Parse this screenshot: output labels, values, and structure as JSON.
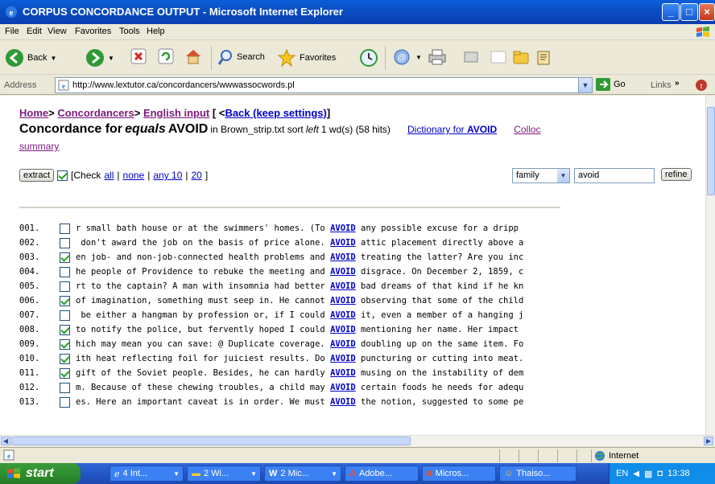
{
  "window": {
    "title": "CORPUS CONCORDANCE OUTPUT - Microsoft Internet Explorer",
    "minimize": "_",
    "maximize": "□",
    "close": "×"
  },
  "menu": [
    "File",
    "Edit",
    "View",
    "Favorites",
    "Tools",
    "Help"
  ],
  "toolbar": {
    "back": "Back",
    "search": "Search",
    "favorites": "Favorites"
  },
  "address": {
    "label": "Address",
    "url": "http://www.lextutor.ca/concordancers/wwwassocwords.pl",
    "go": "Go",
    "links": "Links"
  },
  "page": {
    "breadcrumb": {
      "home": "Home",
      "concordancers": "Concordancers",
      "english_input": "English input",
      "back_open": "[ <",
      "back": "Back (keep settings)",
      "back_close": "]"
    },
    "heading": {
      "concordance_for": "Concordance for",
      "equals": "equals",
      "keyword": "AVOID",
      "in_file": "in Brown_strip.txt sort",
      "left": "left",
      "rest": "1 wd(s) (58 hits)",
      "dictionary": "Dictionary for AVOID",
      "colloc": "Colloc",
      "summary": "summary"
    },
    "controls": {
      "extract": "extract",
      "check_prefix": "[Check",
      "all": "all",
      "none": "none",
      "any10": "any 10",
      "n20": "20",
      "suffix": "]",
      "family": "family",
      "search_value": "avoid",
      "refine": "refine"
    },
    "lines": [
      {
        "num": "001.",
        "checked": false,
        "left": "r small bath house or at the swimmers' homes. (To ",
        "kw": "AVOID",
        "right": " any possible excuse for a dripp"
      },
      {
        "num": "002.",
        "checked": false,
        "left": " don't award the job on the basis of price alone. ",
        "kw": "AVOID",
        "right": " attic placement directly above a"
      },
      {
        "num": "003.",
        "checked": true,
        "left": "en job- and non-job-connected health problems and ",
        "kw": "AVOID",
        "right": " treating the latter? Are you inc"
      },
      {
        "num": "004.",
        "checked": false,
        "left": "he people of Providence to rebuke the meeting and ",
        "kw": "AVOID",
        "right": " disgrace. On December 2, 1859, c"
      },
      {
        "num": "005.",
        "checked": false,
        "left": "rt to the captain? A man with insomnia had better ",
        "kw": "AVOID",
        "right": " bad dreams of that kind if he kn"
      },
      {
        "num": "006.",
        "checked": true,
        "left": "of imagination, something must seep in. He cannot ",
        "kw": "AVOID",
        "right": " observing that some of the child"
      },
      {
        "num": "007.",
        "checked": false,
        "left": " be either a hangman by profession or, if I could ",
        "kw": "AVOID",
        "right": " it, even a member of a hanging j"
      },
      {
        "num": "008.",
        "checked": true,
        "left": "to notify the police, but fervently hoped I could ",
        "kw": "AVOID",
        "right": " mentioning her name. Her impact"
      },
      {
        "num": "009.",
        "checked": true,
        "left": "hich may mean you can save: @ Duplicate coverage. ",
        "kw": "AVOID",
        "right": " doubling up on the same item. Fo"
      },
      {
        "num": "010.",
        "checked": true,
        "left": "ith heat reflecting foil for juiciest results. Do ",
        "kw": "AVOID",
        "right": " puncturing or cutting into meat."
      },
      {
        "num": "011.",
        "checked": true,
        "left": "gift of the Soviet people. Besides, he can hardly ",
        "kw": "AVOID",
        "right": " musing on the instability of dem"
      },
      {
        "num": "012.",
        "checked": false,
        "left": "m. Because of these chewing troubles, a child may ",
        "kw": "AVOID",
        "right": " certain foods he needs for adequ"
      },
      {
        "num": "013.",
        "checked": false,
        "left": "es. Here an important caveat is in order. We must ",
        "kw": "AVOID",
        "right": " the notion, suggested to some pe"
      }
    ]
  },
  "status": {
    "zone": "Internet"
  },
  "taskbar": {
    "start": "start",
    "tasks": [
      "4 Int...",
      "2 Wi...",
      "2 Mic...",
      "Adobe...",
      "Micros...",
      "Thaiso..."
    ],
    "lang": "EN",
    "clock": "13:38"
  }
}
